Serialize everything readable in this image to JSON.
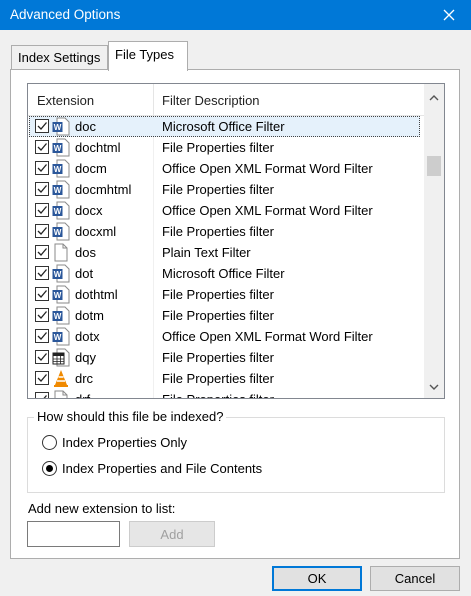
{
  "window": {
    "title": "Advanced Options"
  },
  "tabs": [
    {
      "label": "Index Settings",
      "active": false
    },
    {
      "label": "File Types",
      "active": true
    }
  ],
  "list": {
    "columns": [
      "Extension",
      "Filter Description"
    ],
    "rows": [
      {
        "checked": true,
        "icon": "word-doc-icon",
        "ext": "doc",
        "desc": "Microsoft Office Filter",
        "selected": true
      },
      {
        "checked": true,
        "icon": "word-doc-icon",
        "ext": "dochtml",
        "desc": "File Properties filter"
      },
      {
        "checked": true,
        "icon": "word-doc-icon",
        "ext": "docm",
        "desc": "Office Open XML Format Word Filter"
      },
      {
        "checked": true,
        "icon": "word-doc-icon",
        "ext": "docmhtml",
        "desc": "File Properties filter"
      },
      {
        "checked": true,
        "icon": "word-doc-icon",
        "ext": "docx",
        "desc": "Office Open XML Format Word Filter"
      },
      {
        "checked": true,
        "icon": "word-doc-icon",
        "ext": "docxml",
        "desc": "File Properties filter"
      },
      {
        "checked": true,
        "icon": "blank-file-icon",
        "ext": "dos",
        "desc": "Plain Text Filter"
      },
      {
        "checked": true,
        "icon": "word-doc-icon",
        "ext": "dot",
        "desc": "Microsoft Office Filter"
      },
      {
        "checked": true,
        "icon": "word-doc-icon",
        "ext": "dothtml",
        "desc": "File Properties filter"
      },
      {
        "checked": true,
        "icon": "word-doc-icon",
        "ext": "dotm",
        "desc": "File Properties filter"
      },
      {
        "checked": true,
        "icon": "word-doc-icon",
        "ext": "dotx",
        "desc": "Office Open XML Format Word Filter"
      },
      {
        "checked": true,
        "icon": "query-file-icon",
        "ext": "dqy",
        "desc": "File Properties filter"
      },
      {
        "checked": true,
        "icon": "vlc-cone-icon",
        "ext": "drc",
        "desc": "File Properties filter"
      },
      {
        "checked": true,
        "icon": "blank-file-icon",
        "ext": "drf",
        "desc": "File Properties filter"
      }
    ]
  },
  "index_group": {
    "legend": "How should this file be indexed?",
    "options": [
      {
        "label": "Index Properties Only",
        "selected": false
      },
      {
        "label": "Index Properties and File Contents",
        "selected": true
      }
    ]
  },
  "add_extension": {
    "label": "Add new extension to list:",
    "value": "",
    "button": "Add"
  },
  "buttons": {
    "ok": "OK",
    "cancel": "Cancel"
  },
  "colors": {
    "accent": "#0078d7",
    "word": "#2b579a",
    "vlc": "#f08a00"
  }
}
